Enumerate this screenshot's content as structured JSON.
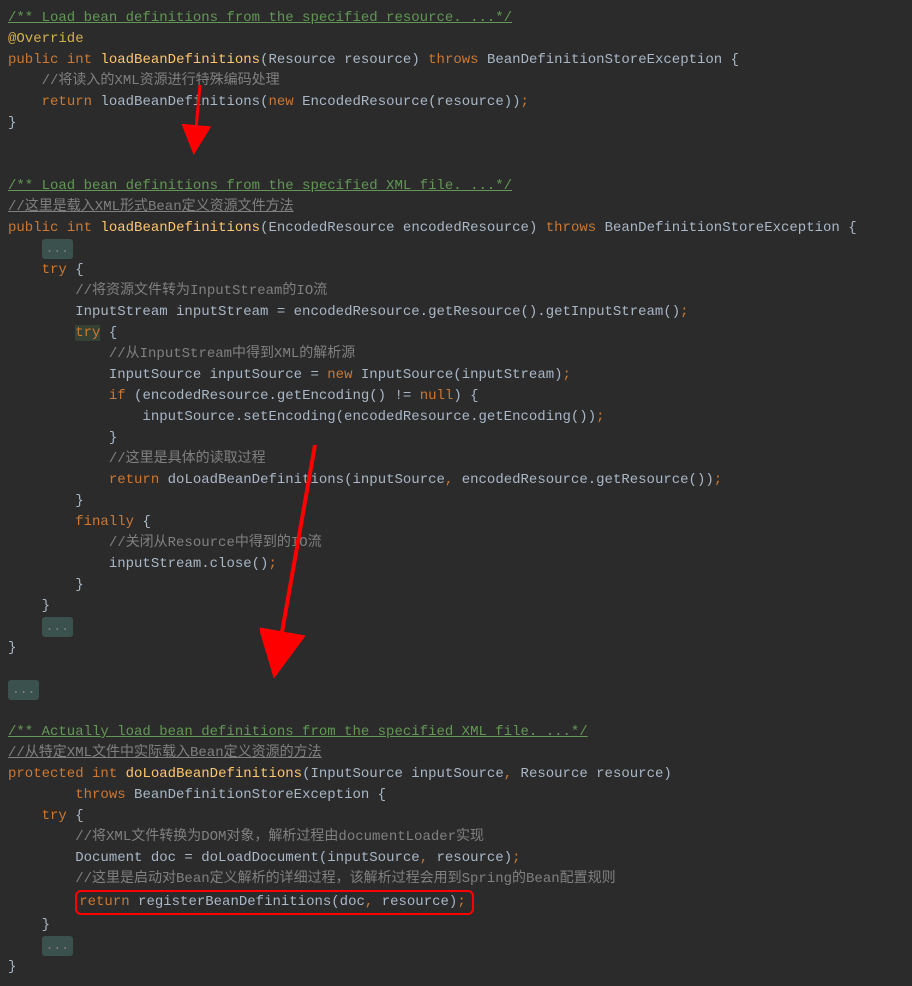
{
  "block1": {
    "comment_top": "/** Load bean definitions from the specified resource. ...*/",
    "annotation": "@Override",
    "sig_public": "public",
    "sig_int": "int",
    "sig_method": "loadBeanDefinitions",
    "sig_param": "(Resource resource)",
    "sig_throws": "throws",
    "sig_exc": "BeanDefinitionStoreException {",
    "cmt1": "//将读入的XML资源进行特殊编码处理",
    "ret": "return",
    "call": "loadBeanDefinitions(",
    "new": "new",
    "enc": "EncodedResource(resource))",
    "semi": ";",
    "close": "}"
  },
  "block2": {
    "doc": "/** Load bean definitions from the specified XML file. ...*/",
    "cn": "//这里是载入XML形式Bean定义资源文件方法",
    "sig_public": "public",
    "sig_int": "int",
    "sig_method": "loadBeanDefinitions",
    "sig_param": "(EncodedResource encodedResource)",
    "sig_throws": "throws",
    "sig_exc": "BeanDefinitionStoreException {",
    "fold1": "...",
    "try": "try",
    "brace": "{",
    "cmt_io": "//将资源文件转为InputStream的IO流",
    "line_is": "InputStream inputStream = encodedResource.getResource().getInputStream()",
    "try2": "try",
    "cmt_parse": "//从InputStream中得到XML的解析源",
    "line_src1": "InputSource inputSource = ",
    "new": "new",
    "line_src2": " InputSource(inputStream)",
    "if": "if",
    "if_cond": "(encodedResource.getEncoding() != ",
    "null": "null",
    "if_end": ") {",
    "set_enc": "inputSource.setEncoding(encodedResource.getEncoding())",
    "close_if": "}",
    "cmt_read": "//这里是具体的读取过程",
    "ret": "return",
    "doload": "doLoadBeanDefinitions(inputSource",
    "comma": ",",
    "doload2": " encodedResource.getResource())",
    "close_try2": "}",
    "finally": "finally",
    "fin_brace": "{",
    "cmt_close": "//关闭从Resource中得到的IO流",
    "close_stream": "inputStream.close()",
    "close_fin": "}",
    "close_try1": "}",
    "fold2": "...",
    "close_method": "}"
  },
  "block3": {
    "fold_top": "...",
    "doc": "/** Actually load bean definitions from the specified XML file. ...*/",
    "cn": "//从特定XML文件中实际载入Bean定义资源的方法",
    "protected": "protected",
    "int": "int",
    "method": "doLoadBeanDefinitions",
    "param": "(InputSource inputSource",
    "comma1": ",",
    "param2": " Resource resource)",
    "throws": "throws",
    "exc": "BeanDefinitionStoreException {",
    "try": "try",
    "brace": "{",
    "cmt_dom": "//将XML文件转换为DOM对象，解析过程由documentLoader实现",
    "doc_line": "Document doc = doLoadDocument(inputSource",
    "comma2": ",",
    "doc_line2": " resource)",
    "cmt_start": "//这里是启动对Bean定义解析的详细过程，该解析过程会用到Spring的Bean配置规则",
    "ret": "return",
    "reg": "registerBeanDefinitions(doc",
    "comma3": ",",
    "reg2": " resource)",
    "close_try": "}",
    "fold_end": "...",
    "close_method": "}"
  }
}
